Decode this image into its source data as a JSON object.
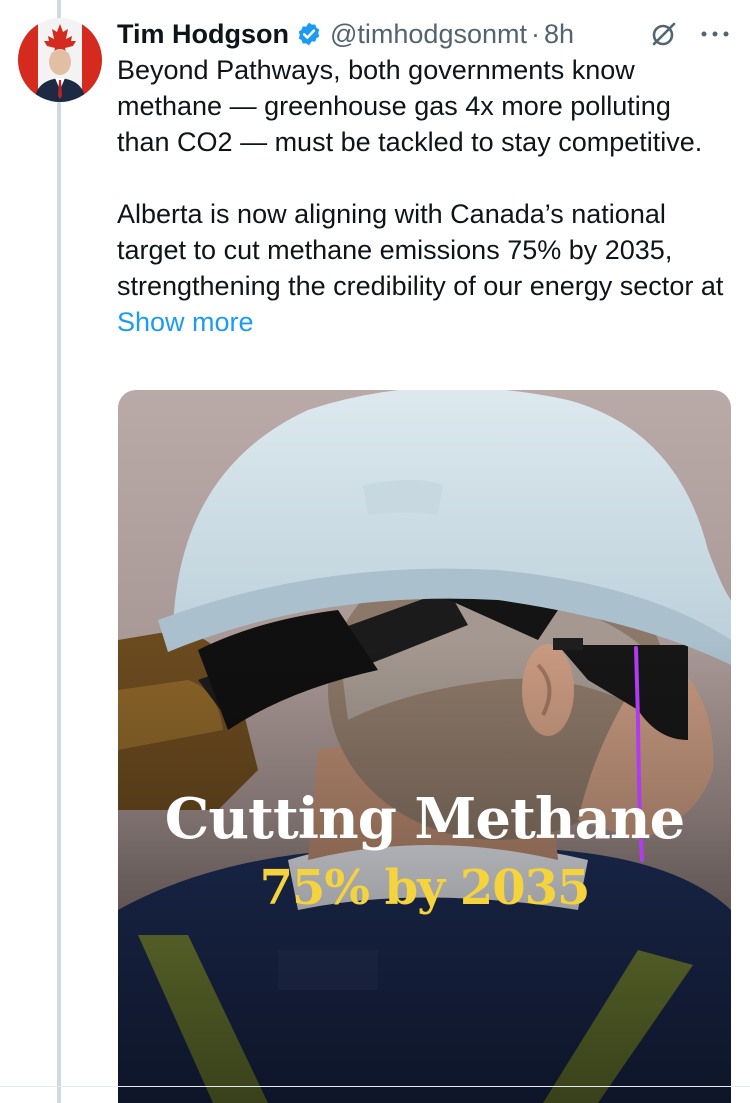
{
  "tweet": {
    "author_name": "Tim Hodgson",
    "handle": "@timhodgsonmt",
    "separator": "·",
    "time": "8h",
    "verified": true,
    "text_paragraph_1": "Beyond Pathways, both governments know methane — greenhouse gas 4x more polluting than CO2 — must be tackled to stay competitive.",
    "text_paragraph_2": "Alberta is now aligning with Canada’s national target to cut methane emissions 75% by 2035, strengthening the credibility of our energy sector at",
    "show_more": "Show more"
  },
  "media": {
    "headline": "Cutting Methane",
    "subheadline": "75% by 2035",
    "headline_color": "#ffffff",
    "subheadline_color": "#f4d33d"
  },
  "icons": {
    "verified": "verified-badge-icon",
    "grok": "grok-icon",
    "more": "more-icon"
  },
  "colors": {
    "accent": "#1d9bf0",
    "secondary_text": "#536471",
    "annotation_stroke": "#b03cf0"
  }
}
